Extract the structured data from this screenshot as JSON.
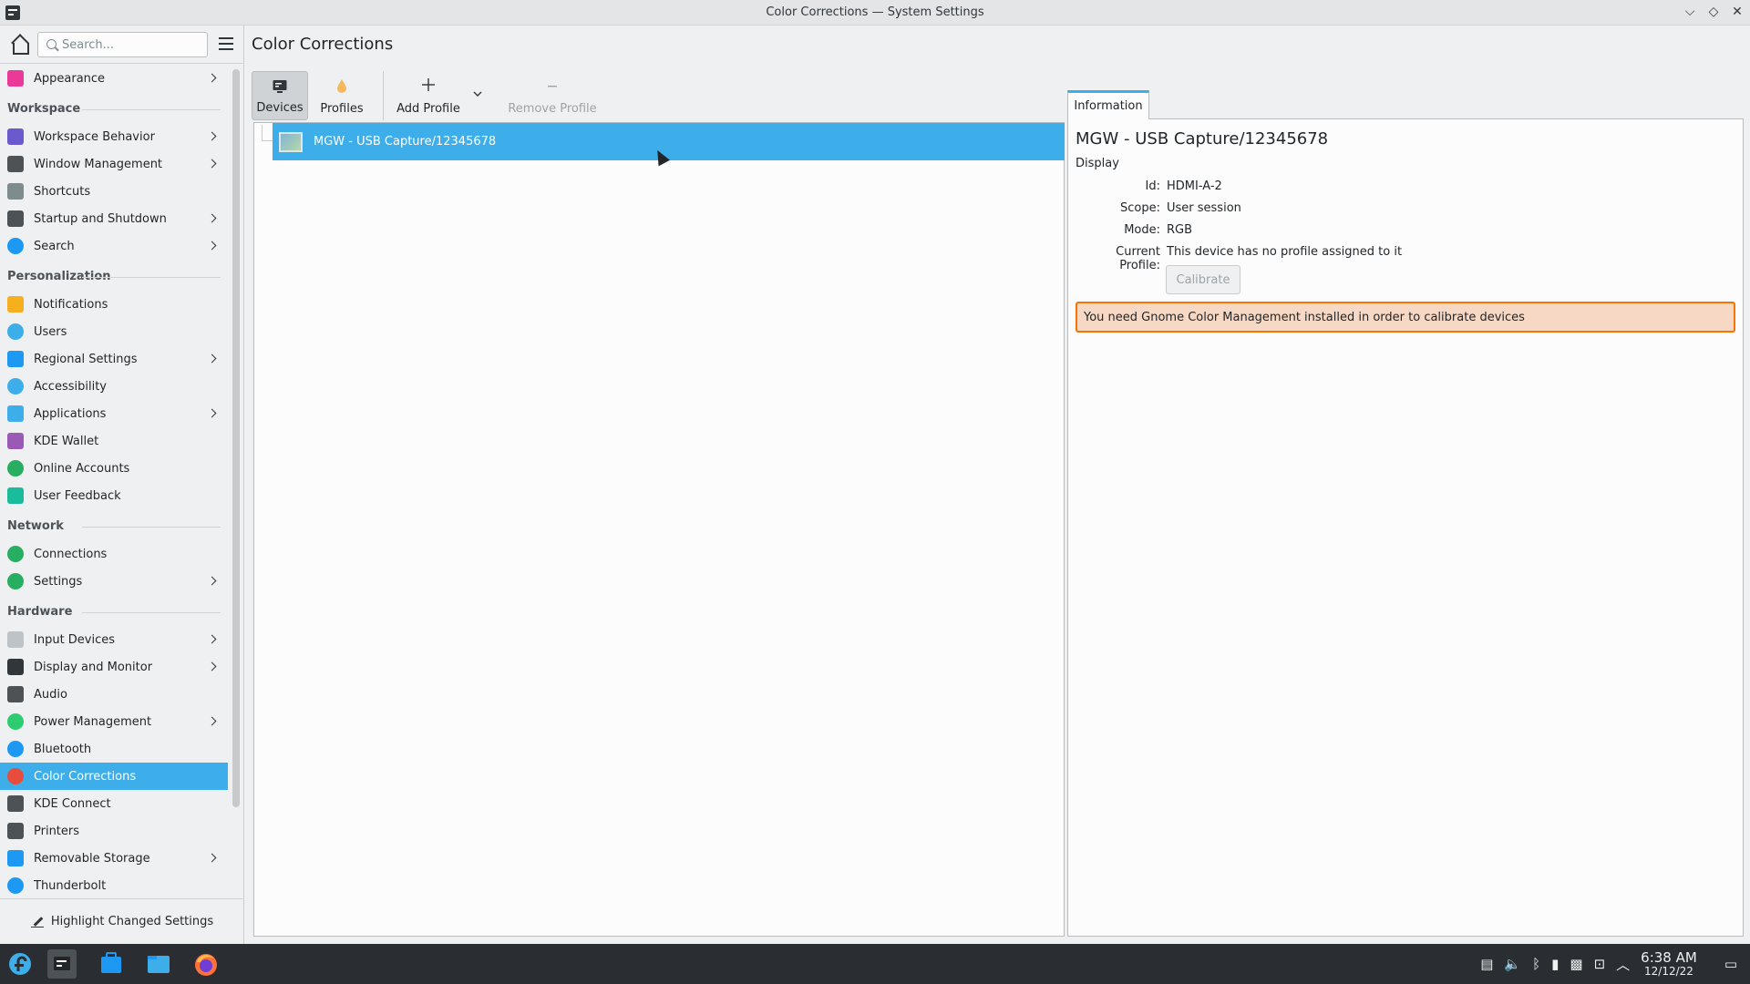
{
  "window": {
    "title": "Color Corrections — System Settings",
    "controls": [
      "⌵",
      "◇",
      "✕"
    ]
  },
  "sidebar": {
    "search_placeholder": "Search...",
    "highlight_label": "Highlight Changed Settings",
    "items": [
      {
        "type": "item",
        "label": "Appearance",
        "chevron": true,
        "icon": "appearance-icon",
        "color": "#e93a9a"
      },
      {
        "type": "section",
        "label": "Workspace"
      },
      {
        "type": "item",
        "label": "Workspace Behavior",
        "chevron": true,
        "icon": "workspace-behavior-icon",
        "color": "#6a5acd"
      },
      {
        "type": "item",
        "label": "Window Management",
        "chevron": true,
        "icon": "window-management-icon",
        "color": "#4d5257"
      },
      {
        "type": "item",
        "label": "Shortcuts",
        "chevron": false,
        "icon": "keyboard-icon",
        "color": "#7f8c8d"
      },
      {
        "type": "item",
        "label": "Startup and Shutdown",
        "chevron": true,
        "icon": "startup-icon",
        "color": "#4d5257"
      },
      {
        "type": "item",
        "label": "Search",
        "chevron": true,
        "icon": "search-icon",
        "color": "#1d99f3"
      },
      {
        "type": "section",
        "label": "Personalization"
      },
      {
        "type": "item",
        "label": "Notifications",
        "chevron": false,
        "icon": "bell-icon",
        "color": "#f6b01f"
      },
      {
        "type": "item",
        "label": "Users",
        "chevron": false,
        "icon": "users-icon",
        "color": "#3daee9"
      },
      {
        "type": "item",
        "label": "Regional Settings",
        "chevron": true,
        "icon": "regional-icon",
        "color": "#1d99f3"
      },
      {
        "type": "item",
        "label": "Accessibility",
        "chevron": false,
        "icon": "accessibility-icon",
        "color": "#3daee9"
      },
      {
        "type": "item",
        "label": "Applications",
        "chevron": true,
        "icon": "applications-icon",
        "color": "#3daee9"
      },
      {
        "type": "item",
        "label": "KDE Wallet",
        "chevron": false,
        "icon": "wallet-icon",
        "color": "#9b59b6"
      },
      {
        "type": "item",
        "label": "Online Accounts",
        "chevron": false,
        "icon": "online-accounts-icon",
        "color": "#27ae60"
      },
      {
        "type": "item",
        "label": "User Feedback",
        "chevron": false,
        "icon": "feedback-icon",
        "color": "#1abc9c"
      },
      {
        "type": "section",
        "label": "Network"
      },
      {
        "type": "item",
        "label": "Connections",
        "chevron": false,
        "icon": "globe-icon",
        "color": "#27ae60"
      },
      {
        "type": "item",
        "label": "Settings",
        "chevron": true,
        "icon": "network-settings-icon",
        "color": "#27ae60"
      },
      {
        "type": "section",
        "label": "Hardware"
      },
      {
        "type": "item",
        "label": "Input Devices",
        "chevron": true,
        "icon": "mouse-icon",
        "color": "#bdc3c7"
      },
      {
        "type": "item",
        "label": "Display and Monitor",
        "chevron": true,
        "icon": "monitor-icon",
        "color": "#31363b"
      },
      {
        "type": "item",
        "label": "Audio",
        "chevron": false,
        "icon": "speaker-icon",
        "color": "#4d5257"
      },
      {
        "type": "item",
        "label": "Power Management",
        "chevron": true,
        "icon": "power-icon",
        "color": "#2ecc71"
      },
      {
        "type": "item",
        "label": "Bluetooth",
        "chevron": false,
        "icon": "bluetooth-icon",
        "color": "#1d99f3"
      },
      {
        "type": "item",
        "label": "Color Corrections",
        "chevron": false,
        "icon": "color-wheel-icon",
        "color": "#e74c3c",
        "active": true
      },
      {
        "type": "item",
        "label": "KDE Connect",
        "chevron": false,
        "icon": "phone-icon",
        "color": "#4d5257"
      },
      {
        "type": "item",
        "label": "Printers",
        "chevron": false,
        "icon": "printer-icon",
        "color": "#4d5257"
      },
      {
        "type": "item",
        "label": "Removable Storage",
        "chevron": true,
        "icon": "usb-icon",
        "color": "#1d99f3"
      },
      {
        "type": "item",
        "label": "Thunderbolt",
        "chevron": false,
        "icon": "thunderbolt-icon",
        "color": "#1d99f3"
      }
    ]
  },
  "main": {
    "title": "Color Corrections",
    "toolbar": {
      "devices": "Devices",
      "profiles": "Profiles",
      "add_profile": "Add Profile",
      "remove_profile": "Remove Profile"
    },
    "devices": [
      {
        "name": "MGW - USB Capture/12345678",
        "selected": true
      }
    ],
    "info": {
      "tab": "Information",
      "title": "MGW - USB Capture/12345678",
      "type": "Display",
      "id_label": "Id:",
      "id_value": "HDMI-A-2",
      "scope_label": "Scope:",
      "scope_value": "User session",
      "mode_label": "Mode:",
      "mode_value": "RGB",
      "profile_label": "Current Profile:",
      "profile_value": "This device has no profile assigned to it",
      "calibrate": "Calibrate",
      "warning": "You need Gnome Color Management installed in order to calibrate devices"
    }
  },
  "taskbar": {
    "time": "6:38 AM",
    "date": "12/12/22"
  },
  "colors": {
    "accent": "#3daee9",
    "warning_border": "#f67400",
    "warning_bg": "#f6d8c4",
    "taskbar": "#2a2e32"
  }
}
